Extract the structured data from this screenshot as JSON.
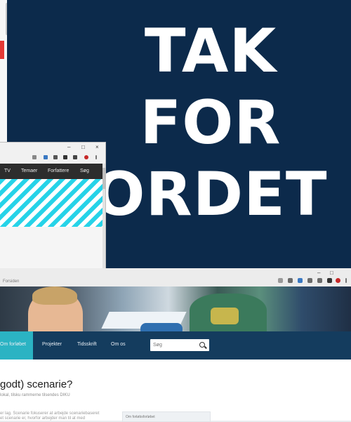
{
  "slide": {
    "title_line1": "TAK FOR",
    "title_line2": "ORDET"
  },
  "small_window": {
    "window_controls": [
      "–",
      "□",
      "×"
    ],
    "nav_items": [
      "TV",
      "Temaer",
      "Forfattere",
      "Søg"
    ]
  },
  "main_window": {
    "tab_label": "Forsiden",
    "window_controls": [
      "–",
      "□"
    ],
    "site_nav": {
      "items": [
        "Om forløbet",
        "Projekter",
        "Tidsskrift",
        "Om os"
      ],
      "search_placeholder": "Søg"
    },
    "content": {
      "heading": "godt) scenarie?",
      "meta": "lokal, tilsku rammerne tilsendes DIKU",
      "para1": "er lag. Scenarie fokuserer at arbejde scenariebaseret",
      "para2": "et scenarie er, hvorfor arbejder man til at med",
      "sidebox_label": "Om forløbsforløbet"
    }
  },
  "colors": {
    "navy": "#0c2a4b",
    "top_strip": "#f3c6bb",
    "site_nav": "#143c5e",
    "active_tab": "#2bb3c3",
    "stripe_cyan": "#26d3e8"
  }
}
